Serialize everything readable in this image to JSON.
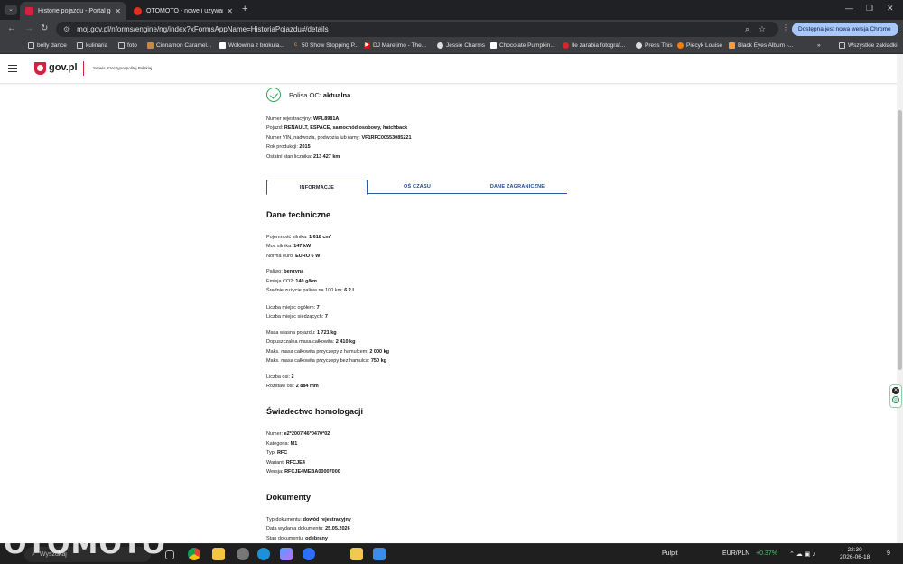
{
  "browser": {
    "tabs": [
      {
        "title": "Historie pojazdu - Portal gov.pl",
        "active": true,
        "favicon_color": "#d4213d"
      },
      {
        "title": "OTOMOTO - nowe i używane s",
        "active": false,
        "favicon_color": "#e0301e"
      }
    ],
    "url": "moj.gov.pl/nforms/engine/ng/index?xFormsAppName=HistoriaPojazdu#/details",
    "update_label": "Dostępna jest nowa wersja Chrome",
    "bookmarks": [
      {
        "label": "belly dance",
        "icon": "folder-icon"
      },
      {
        "label": "kulinaria",
        "icon": "folder-icon"
      },
      {
        "label": "foto",
        "icon": "folder-icon"
      },
      {
        "label": "Cinnamon Caramel...",
        "icon": "site-icon"
      },
      {
        "label": "Wołowina z brokuła...",
        "icon": "site-icon"
      },
      {
        "label": "50 Show Stopping P...",
        "icon": "site-icon"
      },
      {
        "label": "DJ Maretimo - The...",
        "icon": "youtube-icon"
      },
      {
        "label": "Jessie Charms",
        "icon": "site-icon"
      },
      {
        "label": "Chocolate Pumpkin...",
        "icon": "site-icon"
      },
      {
        "label": "Ile zarabia fotograf...",
        "icon": "site-icon"
      },
      {
        "label": "Press This",
        "icon": "site-icon"
      },
      {
        "label": "Piecyk Louise",
        "icon": "site-icon"
      },
      {
        "label": "Black Eyes Album -...",
        "icon": "site-icon"
      }
    ],
    "bookmarks_more": "»",
    "all_bookmarks": "Wszystkie zakładki"
  },
  "site": {
    "logo_text": "gov.pl",
    "service_name": "Serwis Rzeczypospolitej Polskiej"
  },
  "vehicle": {
    "oc_label": "Polisa OC:",
    "oc_value": "aktualna",
    "summary": [
      {
        "label": "Numer rejestracyjny:",
        "value": "WPL8981A"
      },
      {
        "label": "Pojazd:",
        "value": "RENAULT, ESPACE, samochód osobowy, hatchback"
      },
      {
        "label": "Numer VIN, nadwozia, podwozia lub ramy:",
        "value": "VF1RFC00553085221"
      },
      {
        "label": "Rok produkcji:",
        "value": "2015"
      },
      {
        "label": "Ostatni stan licznika:",
        "value": "213 427 km"
      }
    ]
  },
  "page_tabs": [
    {
      "label": "INFORMACJE",
      "active": true
    },
    {
      "label": "OŚ CZASU",
      "active": false
    },
    {
      "label": "DANE ZAGRANICZNE",
      "active": false
    }
  ],
  "tech": {
    "heading": "Dane techniczne",
    "groups": [
      [
        {
          "label": "Pojemność silnika:",
          "value": "1 618 cm³"
        },
        {
          "label": "Moc silnika:",
          "value": "147 kW"
        },
        {
          "label": "Norma euro:",
          "value": "EURO 6 W"
        }
      ],
      [
        {
          "label": "Paliwo:",
          "value": "benzyna"
        },
        {
          "label": "Emisja CO2:",
          "value": "140 g/km"
        },
        {
          "label": "Średnie zużycie paliwa na 100 km:",
          "value": "6.2 l"
        }
      ],
      [
        {
          "label": "Liczba miejsc ogółem:",
          "value": "7"
        },
        {
          "label": "Liczba miejsc siedzących:",
          "value": "7"
        }
      ],
      [
        {
          "label": "Masa własna pojazdu:",
          "value": "1 721 kg"
        },
        {
          "label": "Dopuszczalna masa całkowita:",
          "value": "2 410 kg"
        },
        {
          "label": "Maks. masa całkowita przyczepy z hamulcem:",
          "value": "2 000 kg"
        },
        {
          "label": "Maks. masa całkowita przyczepy bez hamulca:",
          "value": "750 kg"
        }
      ],
      [
        {
          "label": "Liczba osi:",
          "value": "2"
        },
        {
          "label": "Rozstaw osi:",
          "value": "2 884 mm"
        }
      ]
    ]
  },
  "homologation": {
    "heading": "Świadectwo homologacji",
    "items": [
      {
        "label": "Numer:",
        "value": "e2*2007/46*0470*02"
      },
      {
        "label": "Kategoria:",
        "value": "M1"
      },
      {
        "label": "Typ:",
        "value": "RFC"
      },
      {
        "label": "Wariant:",
        "value": "RFCJE4"
      },
      {
        "label": "Wersja:",
        "value": "RFCJE4MEBA00007000"
      }
    ]
  },
  "documents": {
    "heading": "Dokumenty",
    "items": [
      {
        "label": "Typ dokumentu:",
        "value": "dowód rejestracyjny"
      },
      {
        "label": "Data wydania dokumentu:",
        "value": "25.05.2026"
      },
      {
        "label": "Stan dokumentu:",
        "value": "odebrany"
      }
    ]
  },
  "taskbar": {
    "search_placeholder": "Wyszukaj",
    "watermark": "OTOMOTO",
    "desktop_label": "Pulpit",
    "currency": "EUR/PLN",
    "currency_change": "+0.37%",
    "time": "22:30",
    "date": "2026-06-18",
    "notifications": "9"
  }
}
